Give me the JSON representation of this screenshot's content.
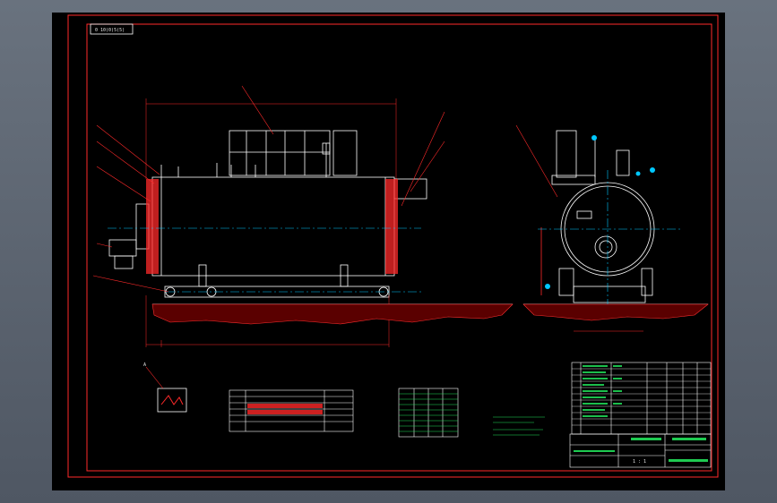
{
  "drawing": {
    "drawing_code": "0 10(0)5(5)",
    "colors": {
      "background": "#000000",
      "frame": "#ff2a2a",
      "outline": "#ffffff",
      "centerline": "#00c8ff",
      "table_lines": "#ffffff",
      "table_text": "#22e05a",
      "ground_fill": "#ff3030"
    },
    "detail_callout": "A",
    "scale_label": "1 : 1"
  }
}
